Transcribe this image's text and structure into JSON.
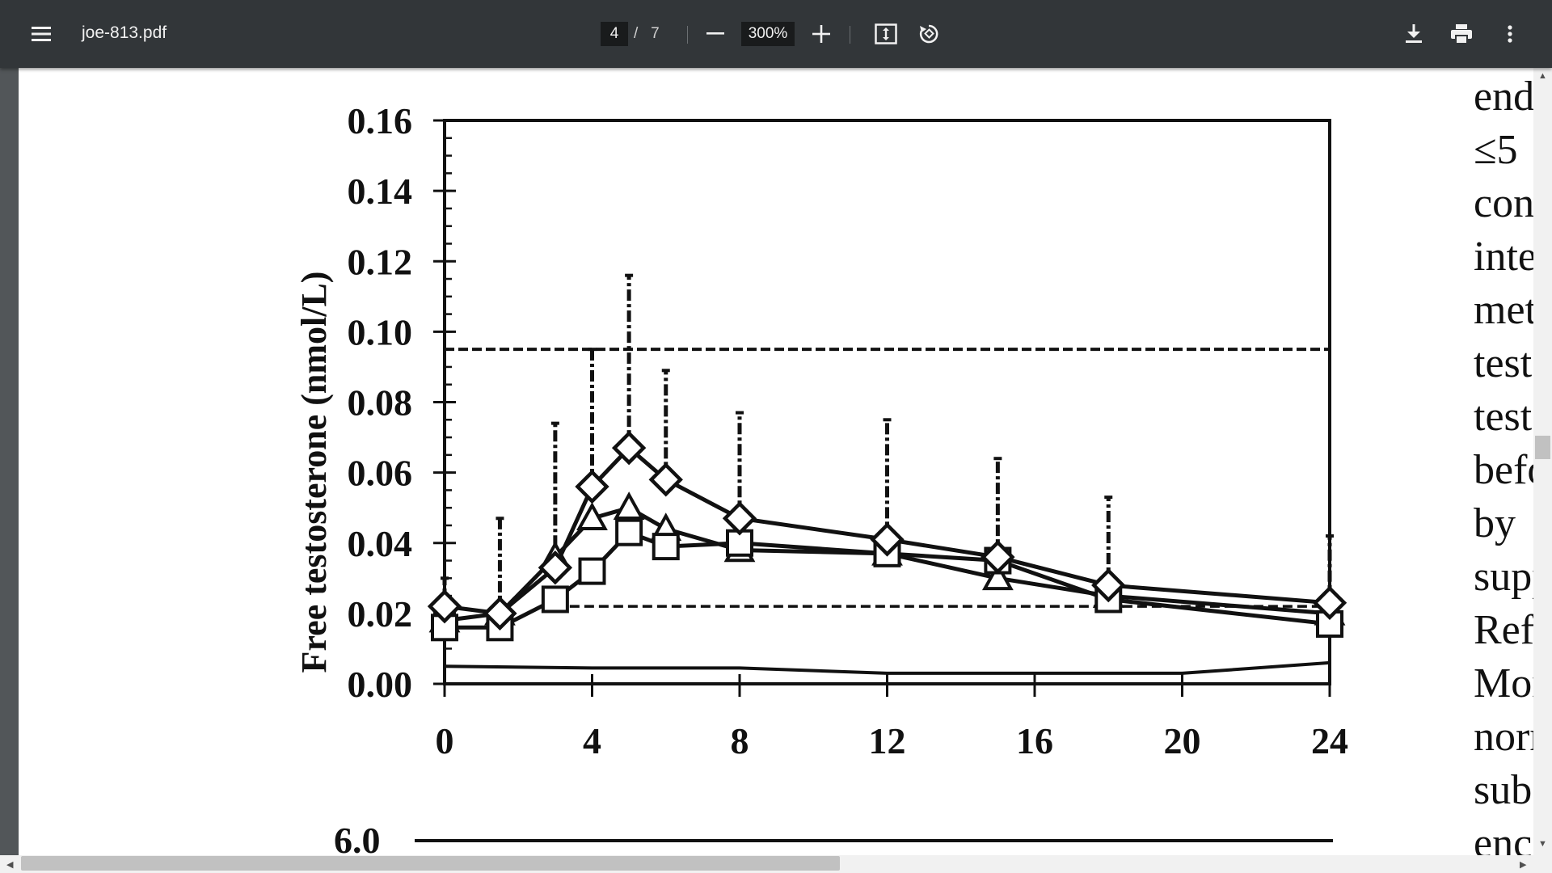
{
  "toolbar": {
    "menu_icon": "hamburger-menu-icon",
    "file_name": "joe-813.pdf",
    "current_page": "4",
    "page_separator": "/",
    "total_pages": "7",
    "zoom_out_icon": "minus-icon",
    "zoom_level": "300%",
    "zoom_in_icon": "plus-icon",
    "fit_icon": "fit-to-page-icon",
    "rotate_icon": "rotate-icon",
    "download_icon": "download-icon",
    "print_icon": "print-icon",
    "more_icon": "more-vertical-icon"
  },
  "document": {
    "right_column_lines": [
      "endo",
      "≤5",
      "conc",
      "inter",
      "meth",
      "testo",
      "testo",
      "befo",
      "by",
      "supp",
      "Refe",
      "Mon",
      "norm",
      "subs",
      "ence"
    ],
    "next_chart_y_tick": "6.0"
  },
  "chart_data": {
    "type": "line",
    "ylabel": "Free testosterone (nmol/L)",
    "xlabel": "",
    "x_ticks": [
      "0",
      "4",
      "8",
      "12",
      "16",
      "20",
      "24"
    ],
    "y_ticks": [
      "0.00",
      "0.02",
      "0.04",
      "0.06",
      "0.08",
      "0.10",
      "0.12",
      "0.14",
      "0.16"
    ],
    "xlim": [
      0,
      24
    ],
    "ylim": [
      0,
      0.16
    ],
    "reference_range": {
      "upper": 0.095,
      "lower": 0.022
    },
    "baseline_line": {
      "x": [
        0,
        4,
        8,
        12,
        16,
        20,
        24
      ],
      "values": [
        0.005,
        0.0045,
        0.0045,
        0.003,
        0.003,
        0.003,
        0.006
      ]
    },
    "series": [
      {
        "marker": "diamond",
        "x": [
          0,
          1.5,
          3,
          4,
          5,
          6,
          8,
          12,
          15,
          18,
          24
        ],
        "values": [
          0.022,
          0.02,
          0.033,
          0.056,
          0.067,
          0.058,
          0.047,
          0.041,
          0.036,
          0.028,
          0.023
        ],
        "error_upper": [
          0.03,
          0.047,
          0.074,
          0.095,
          0.116,
          0.089,
          0.077,
          0.075,
          0.064,
          0.053,
          0.042
        ]
      },
      {
        "marker": "triangle",
        "x": [
          0,
          1.5,
          3,
          4,
          5,
          6,
          8,
          12,
          15,
          18,
          24
        ],
        "values": [
          0.018,
          0.02,
          0.036,
          0.047,
          0.05,
          0.044,
          0.038,
          0.037,
          0.03,
          0.025,
          0.02
        ]
      },
      {
        "marker": "square",
        "x": [
          0,
          1.5,
          3,
          4,
          5,
          6,
          8,
          12,
          15,
          18,
          24
        ],
        "values": [
          0.016,
          0.016,
          0.024,
          0.032,
          0.043,
          0.039,
          0.04,
          0.037,
          0.035,
          0.024,
          0.017
        ]
      }
    ]
  }
}
